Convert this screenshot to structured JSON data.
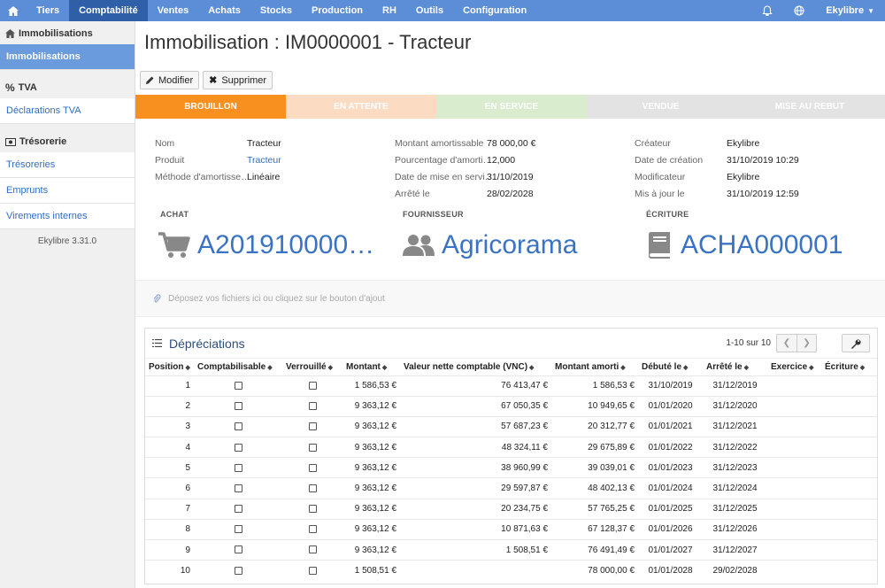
{
  "topbar": {
    "tabs": [
      "Tiers",
      "Comptabilité",
      "Ventes",
      "Achats",
      "Stocks",
      "Production",
      "RH",
      "Outils",
      "Configuration"
    ],
    "active_tab": "Comptabilité",
    "user": "Ekylibre"
  },
  "sidebar": {
    "section1": {
      "title": "Immobilisations",
      "items": [
        "Immobilisations"
      ]
    },
    "section2": {
      "title": "TVA",
      "items": [
        "Déclarations TVA"
      ]
    },
    "section3": {
      "title": "Trésorerie",
      "items": [
        "Trésoreries",
        "Emprunts",
        "Virements internes"
      ]
    },
    "version": "Ekylibre 3.31.0"
  },
  "page": {
    "title": "Immobilisation : IM0000001 - Tracteur",
    "buttons": {
      "edit": "Modifier",
      "delete": "Supprimer"
    },
    "stages": [
      {
        "label": "BROUILLON",
        "color": "#f7901e"
      },
      {
        "label": "EN ATTENTE",
        "color": "#fbdcc3"
      },
      {
        "label": "EN SERVICE",
        "color": "#d9eccd"
      },
      {
        "label": "VENDUE",
        "color": "#e3e3e3"
      },
      {
        "label": "MISE AU REBUT",
        "color": "#e3e3e3"
      }
    ],
    "info_left": [
      {
        "label": "Nom",
        "value": "Tracteur"
      },
      {
        "label": "Produit",
        "value": "Tracteur"
      },
      {
        "label": "Méthode d'amortisse…",
        "value": "Linéaire"
      }
    ],
    "info_mid": [
      {
        "label": "Montant amortissable",
        "value": "78 000,00 €"
      },
      {
        "label": "Pourcentage d'amorti…",
        "value": "12,000"
      },
      {
        "label": "Date de mise en servi…",
        "value": "31/10/2019"
      },
      {
        "label": "Arrêté le",
        "value": "28/02/2028"
      }
    ],
    "info_right": [
      {
        "label": "Créateur",
        "value": "Ekylibre"
      },
      {
        "label": "Date de création",
        "value": "31/10/2019 10:29"
      },
      {
        "label": "Modificateur",
        "value": "Ekylibre"
      },
      {
        "label": "Mis à jour le",
        "value": "31/10/2019 12:59"
      }
    ],
    "links": [
      {
        "label": "ACHAT",
        "value": "A201910000…",
        "icon": "cart-icon"
      },
      {
        "label": "FOURNISSEUR",
        "value": "Agricorama",
        "icon": "users-icon"
      },
      {
        "label": "ÉCRITURE",
        "value": "ACHA000001",
        "icon": "book-icon"
      }
    ],
    "dropzone": "Déposez vos fichiers ici ou cliquez sur le bouton d'ajout"
  },
  "depreciations": {
    "title": "Dépréciations",
    "pager": "1-10 sur 10",
    "columns": [
      "Position",
      "Comptabilisable",
      "Verrouillé",
      "Montant",
      "Valeur nette comptable (VNC)",
      "Montant amorti",
      "Débuté le",
      "Arrêté le",
      "Exercice",
      "Écriture"
    ],
    "rows": [
      [
        "1",
        "1 586,53 €",
        "76 413,47 €",
        "1 586,53 €",
        "31/10/2019",
        "31/12/2019"
      ],
      [
        "2",
        "9 363,12 €",
        "67 050,35 €",
        "10 949,65 €",
        "01/01/2020",
        "31/12/2020"
      ],
      [
        "3",
        "9 363,12 €",
        "57 687,23 €",
        "20 312,77 €",
        "01/01/2021",
        "31/12/2021"
      ],
      [
        "4",
        "9 363,12 €",
        "48 324,11 €",
        "29 675,89 €",
        "01/01/2022",
        "31/12/2022"
      ],
      [
        "5",
        "9 363,12 €",
        "38 960,99 €",
        "39 039,01 €",
        "01/01/2023",
        "31/12/2023"
      ],
      [
        "6",
        "9 363,12 €",
        "29 597,87 €",
        "48 402,13 €",
        "01/01/2024",
        "31/12/2024"
      ],
      [
        "7",
        "9 363,12 €",
        "20 234,75 €",
        "57 765,25 €",
        "01/01/2025",
        "31/12/2025"
      ],
      [
        "8",
        "9 363,12 €",
        "10 871,63 €",
        "67 128,37 €",
        "01/01/2026",
        "31/12/2026"
      ],
      [
        "9",
        "9 363,12 €",
        "1 508,51 €",
        "76 491,49 €",
        "01/01/2027",
        "31/12/2027"
      ],
      [
        "10",
        "1 508,51 €",
        "",
        "78 000,00 €",
        "01/01/2028",
        "29/02/2028"
      ]
    ]
  }
}
